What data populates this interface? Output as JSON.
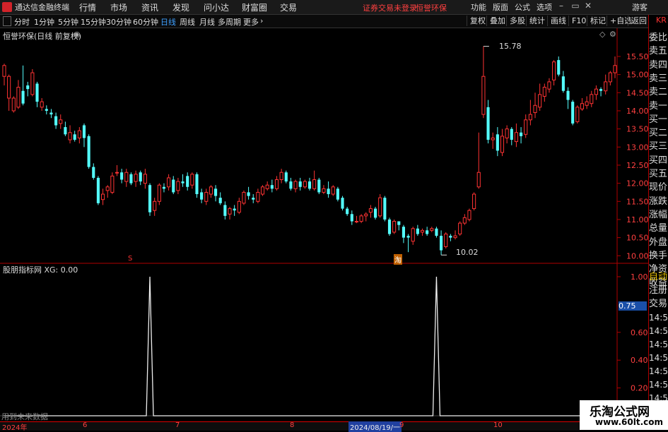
{
  "app": {
    "title": "通达信金融终端",
    "menu": [
      "行情",
      "市场",
      "资讯",
      "发现",
      "问小达",
      "财富圈",
      "交易"
    ],
    "login_status": "证券交易未登录",
    "stock_name": "恒誉环保",
    "right_menu": [
      "功能",
      "版面",
      "公式",
      "选项"
    ],
    "user": "游客"
  },
  "toolbar": {
    "periods": [
      "分时",
      "1分钟",
      "5分钟",
      "15分钟",
      "30分钟",
      "60分钟",
      "日线",
      "周线",
      "月线",
      "多周期",
      "更多"
    ],
    "active_period": "日线",
    "buttons": [
      "复权",
      "叠加",
      "多股",
      "统计",
      "画线",
      "F10",
      "标记",
      "+自选",
      "返回"
    ]
  },
  "main_chart": {
    "header": "恒誉环保(日线 前复权)",
    "y_ticks": [
      "15.50",
      "15.00",
      "14.50",
      "14.00",
      "13.50",
      "13.00",
      "12.50",
      "12.00",
      "11.50",
      "11.00",
      "10.50",
      "10.00"
    ],
    "high_label": "15.78",
    "low_label": "10.02",
    "marker_s": "S",
    "marker_tao": "淘",
    "colors": {
      "up": "#ff3333",
      "down": "#54ffff",
      "axis": "#b00000",
      "text": "#ff4040"
    }
  },
  "chart_data": {
    "type": "candlestick",
    "ylim": [
      9.85,
      15.85
    ],
    "candles": [
      [
        14.95,
        15.25,
        14.7,
        15.3
      ],
      [
        14.35,
        14.95,
        14.0,
        15.0
      ],
      [
        14.0,
        14.35,
        13.95,
        14.4
      ],
      [
        14.1,
        14.65,
        14.05,
        14.85
      ],
      [
        14.55,
        14.2,
        14.15,
        15.25
      ],
      [
        14.7,
        14.6,
        14.4,
        14.8
      ],
      [
        14.45,
        15.05,
        14.4,
        15.15
      ],
      [
        14.75,
        14.25,
        14.1,
        14.8
      ],
      [
        14.1,
        14.25,
        14.0,
        14.35
      ],
      [
        14.05,
        14.0,
        13.9,
        14.15
      ],
      [
        13.95,
        13.9,
        13.8,
        14.05
      ],
      [
        13.85,
        13.6,
        13.5,
        13.95
      ],
      [
        13.65,
        13.75,
        13.5,
        13.9
      ],
      [
        13.55,
        13.35,
        13.3,
        13.7
      ],
      [
        13.2,
        13.4,
        13.1,
        13.6
      ],
      [
        13.35,
        13.2,
        13.15,
        13.45
      ],
      [
        13.25,
        13.45,
        13.1,
        13.55
      ],
      [
        13.6,
        13.25,
        13.0,
        13.65
      ],
      [
        13.3,
        12.45,
        12.4,
        13.35
      ],
      [
        12.45,
        12.15,
        12.1,
        12.55
      ],
      [
        12.15,
        11.45,
        11.4,
        12.2
      ],
      [
        11.55,
        11.7,
        11.4,
        11.85
      ],
      [
        11.8,
        11.9,
        11.6,
        11.95
      ],
      [
        11.75,
        12.2,
        11.7,
        12.3
      ],
      [
        12.3,
        12.3,
        12.2,
        12.5
      ],
      [
        12.3,
        12.1,
        12.0,
        12.4
      ],
      [
        12.05,
        12.3,
        11.9,
        12.4
      ],
      [
        12.25,
        12.0,
        11.95,
        12.3
      ],
      [
        12.05,
        12.25,
        11.9,
        12.35
      ],
      [
        12.3,
        12.05,
        11.95,
        12.35
      ],
      [
        12.0,
        12.25,
        11.85,
        12.4
      ],
      [
        11.95,
        11.2,
        11.1,
        12.0
      ],
      [
        11.25,
        11.5,
        11.1,
        11.6
      ],
      [
        11.5,
        11.95,
        11.4,
        12.0
      ],
      [
        11.9,
        11.85,
        11.75,
        12.0
      ],
      [
        11.9,
        12.15,
        11.8,
        12.25
      ],
      [
        12.1,
        11.75,
        11.7,
        12.2
      ],
      [
        11.8,
        12.05,
        11.7,
        12.15
      ],
      [
        12.05,
        12.0,
        11.9,
        12.25
      ],
      [
        12.2,
        11.9,
        11.8,
        12.3
      ],
      [
        11.95,
        12.25,
        11.85,
        12.3
      ],
      [
        12.25,
        11.7,
        11.6,
        12.3
      ],
      [
        11.75,
        11.55,
        11.45,
        11.85
      ],
      [
        11.5,
        11.75,
        11.4,
        11.85
      ],
      [
        11.7,
        11.9,
        11.6,
        11.95
      ],
      [
        11.85,
        11.65,
        11.5,
        11.95
      ],
      [
        11.6,
        11.45,
        11.4,
        11.75
      ],
      [
        11.4,
        11.1,
        11.0,
        11.5
      ],
      [
        11.15,
        11.3,
        11.0,
        11.35
      ],
      [
        11.3,
        11.25,
        11.1,
        11.4
      ],
      [
        11.2,
        11.5,
        11.15,
        11.6
      ],
      [
        11.45,
        11.75,
        11.4,
        11.8
      ],
      [
        11.75,
        11.65,
        11.55,
        11.9
      ],
      [
        11.6,
        11.55,
        11.45,
        11.7
      ],
      [
        11.5,
        11.75,
        11.45,
        11.85
      ],
      [
        11.7,
        11.9,
        11.65,
        11.95
      ],
      [
        11.85,
        11.95,
        11.8,
        12.05
      ],
      [
        11.95,
        11.85,
        11.75,
        12.1
      ],
      [
        11.85,
        12.1,
        11.8,
        12.2
      ],
      [
        12.1,
        12.3,
        12.0,
        12.4
      ],
      [
        12.3,
        12.05,
        12.0,
        12.35
      ],
      [
        12.05,
        11.85,
        11.8,
        12.15
      ],
      [
        11.85,
        12.05,
        11.75,
        12.1
      ],
      [
        12.05,
        11.9,
        11.8,
        12.15
      ],
      [
        11.9,
        12.05,
        11.85,
        12.1
      ],
      [
        12.05,
        11.85,
        11.8,
        12.15
      ],
      [
        11.85,
        12.1,
        11.8,
        12.35
      ],
      [
        12.1,
        11.75,
        11.7,
        12.15
      ],
      [
        11.75,
        11.85,
        11.7,
        11.95
      ],
      [
        11.85,
        11.7,
        11.6,
        12.05
      ],
      [
        11.7,
        11.9,
        11.65,
        11.95
      ],
      [
        11.85,
        11.55,
        11.5,
        11.9
      ],
      [
        11.6,
        11.3,
        11.25,
        11.65
      ],
      [
        11.3,
        11.15,
        11.1,
        11.35
      ],
      [
        11.15,
        10.95,
        10.85,
        11.25
      ],
      [
        10.95,
        10.95,
        10.9,
        11.1
      ],
      [
        10.95,
        11.1,
        10.9,
        11.15
      ],
      [
        11.1,
        11.15,
        10.95,
        11.2
      ],
      [
        11.2,
        11.3,
        11.05,
        11.4
      ],
      [
        11.3,
        11.05,
        11.0,
        11.35
      ],
      [
        11.1,
        11.6,
        11.05,
        11.7
      ],
      [
        11.6,
        11.0,
        10.95,
        11.65
      ],
      [
        11.0,
        10.6,
        10.55,
        11.05
      ],
      [
        10.65,
        10.95,
        10.6,
        11.0
      ],
      [
        10.95,
        10.85,
        10.7,
        10.95
      ],
      [
        10.8,
        10.5,
        10.35,
        10.85
      ],
      [
        10.55,
        10.5,
        10.1,
        10.6
      ],
      [
        10.4,
        10.75,
        10.3,
        10.8
      ],
      [
        10.75,
        10.6,
        10.55,
        10.85
      ],
      [
        10.65,
        10.7,
        10.55,
        10.75
      ],
      [
        10.7,
        10.6,
        10.55,
        10.8
      ],
      [
        10.7,
        10.75,
        10.65,
        10.8
      ],
      [
        10.75,
        10.55,
        10.5,
        10.8
      ],
      [
        10.55,
        10.15,
        10.02,
        10.7
      ],
      [
        10.25,
        10.6,
        10.2,
        10.65
      ],
      [
        10.55,
        10.5,
        10.4,
        10.6
      ],
      [
        10.5,
        10.55,
        10.45,
        10.7
      ],
      [
        10.6,
        10.9,
        10.55,
        10.95
      ],
      [
        10.9,
        11.05,
        10.85,
        11.15
      ],
      [
        11.0,
        11.25,
        10.95,
        11.3
      ],
      [
        11.3,
        11.7,
        11.25,
        11.75
      ],
      [
        11.9,
        12.3,
        11.85,
        13.4
      ],
      [
        13.9,
        14.95,
        13.8,
        15.78
      ],
      [
        14.1,
        13.2,
        13.1,
        14.3
      ],
      [
        13.2,
        13.25,
        12.95,
        13.4
      ],
      [
        13.35,
        12.9,
        12.75,
        13.55
      ],
      [
        12.85,
        13.3,
        12.75,
        13.5
      ],
      [
        13.25,
        13.5,
        13.1,
        13.6
      ],
      [
        13.5,
        13.2,
        13.05,
        13.55
      ],
      [
        13.15,
        13.4,
        13.0,
        13.65
      ],
      [
        13.4,
        13.3,
        13.1,
        13.55
      ],
      [
        13.35,
        13.75,
        13.25,
        13.9
      ],
      [
        13.75,
        13.9,
        13.6,
        14.3
      ],
      [
        13.95,
        14.15,
        13.8,
        14.5
      ],
      [
        14.1,
        14.45,
        14.0,
        14.75
      ],
      [
        14.4,
        14.65,
        14.25,
        14.75
      ],
      [
        14.6,
        14.8,
        14.5,
        14.9
      ],
      [
        14.85,
        15.35,
        14.7,
        15.4
      ],
      [
        15.4,
        15.0,
        14.95,
        15.5
      ],
      [
        14.95,
        14.55,
        14.5,
        15.1
      ],
      [
        14.55,
        14.3,
        14.05,
        14.65
      ],
      [
        14.25,
        13.65,
        13.6,
        14.3
      ],
      [
        13.7,
        14.1,
        13.65,
        14.15
      ],
      [
        14.05,
        14.2,
        14.0,
        14.35
      ],
      [
        14.15,
        14.25,
        14.05,
        14.4
      ],
      [
        14.2,
        14.45,
        14.1,
        14.55
      ],
      [
        14.45,
        14.6,
        14.3,
        14.7
      ],
      [
        14.6,
        14.55,
        14.4,
        14.65
      ],
      [
        14.55,
        14.8,
        14.45,
        15.0
      ],
      [
        14.8,
        15.05,
        14.7,
        15.1
      ],
      [
        15.05,
        15.25,
        14.9,
        15.5
      ]
    ]
  },
  "indicator": {
    "header": "股朋指标网 XG: 0.00",
    "y_ticks": [
      "1.00",
      "0.60",
      "0.40",
      "0.20"
    ],
    "highlight_value": "0.75",
    "note": "用到未来数据",
    "signal_values": [
      0,
      0,
      0,
      0,
      0,
      0,
      0,
      0,
      0,
      0,
      0,
      0,
      0,
      0,
      0,
      0,
      0,
      0,
      0,
      0,
      0,
      0,
      0,
      0,
      0,
      0,
      0,
      0,
      0,
      0,
      0,
      1,
      0,
      0,
      0,
      0,
      0,
      0,
      0,
      0,
      0,
      0,
      0,
      0,
      0,
      0,
      0,
      0,
      0,
      0,
      0,
      0,
      0,
      0,
      0,
      0,
      0,
      0,
      0,
      0,
      0,
      0,
      0,
      0,
      0,
      0,
      0,
      0,
      0,
      0,
      0,
      0,
      0,
      0,
      0,
      0,
      0,
      0,
      0,
      0,
      0,
      0,
      0,
      0,
      0,
      0,
      0,
      0,
      0,
      0,
      0,
      0,
      1,
      0,
      0,
      0,
      0,
      0,
      0,
      0,
      0,
      0,
      0,
      0,
      0,
      0,
      0,
      0,
      0,
      0,
      0,
      0,
      0,
      0,
      0,
      0,
      0,
      0,
      0,
      0,
      0,
      0,
      0,
      0,
      0,
      0,
      0,
      0,
      0,
      0,
      0
    ]
  },
  "time_axis": {
    "labels": [
      "2024年",
      "6",
      "7",
      "8",
      "2024/08/19/一",
      "9",
      "10"
    ],
    "highlight": "2024/08/19/一"
  },
  "side_panel": {
    "top_code": "KR",
    "items": [
      "委比",
      "卖五",
      "卖四",
      "卖三",
      "卖二",
      "卖一",
      "买一",
      "买二",
      "买三",
      "买四",
      "买五",
      "现价",
      "涨跌",
      "涨幅",
      "总量",
      "外盘",
      "换手",
      "净资",
      "收益"
    ],
    "lower_items": [
      "自动",
      "注册",
      "交易"
    ],
    "times": [
      "14:55",
      "14:55",
      "14:55",
      "14:55",
      "14:55",
      "14:55",
      "14:56",
      "14:56"
    ]
  },
  "watermark": {
    "title": "乐淘公式网",
    "url": "www.60lt.com"
  }
}
